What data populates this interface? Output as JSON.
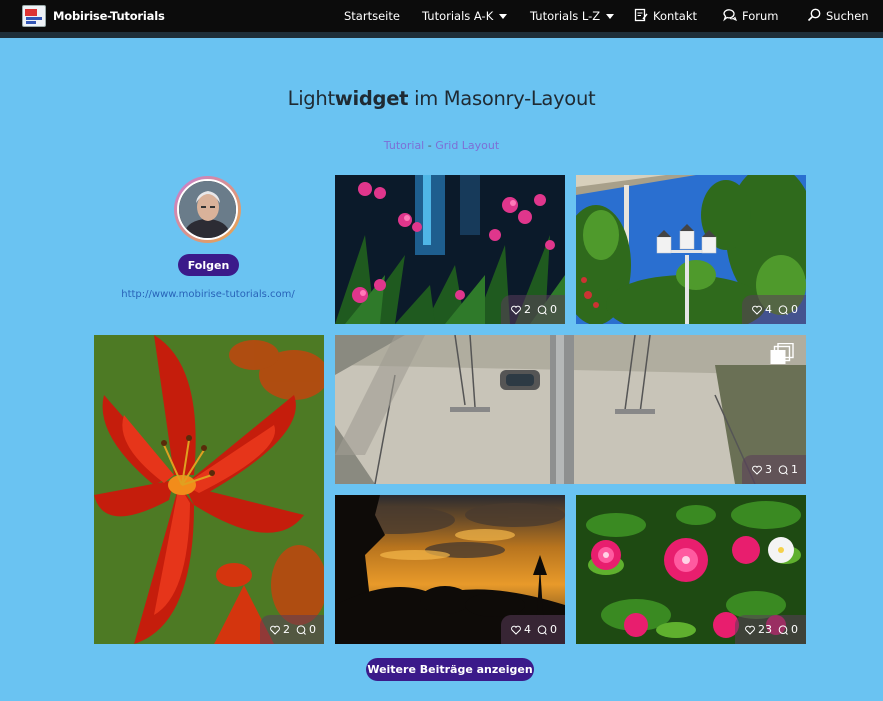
{
  "nav": {
    "brand": "Mobirise-Tutorials",
    "items": [
      {
        "label": "Startseite"
      },
      {
        "label": "Tutorials A-K"
      },
      {
        "label": "Tutorials L-Z"
      },
      {
        "label": "Kontakt",
        "icon": "form-icon"
      },
      {
        "label": "Forum",
        "icon": "chat-icon"
      },
      {
        "label": "Suchen",
        "icon": "search-icon"
      }
    ]
  },
  "header": {
    "title_pre": "Light",
    "title_bold": "widget",
    "title_post": " im Masonry-Layout",
    "crumb_1": "Tutorial",
    "crumb_sep": " - ",
    "crumb_2": "Grid Layout"
  },
  "profile": {
    "follow_label": "Folgen",
    "site_url": "http://www.mobirise-tutorials.com/"
  },
  "posts": [
    {
      "likes": "2",
      "comments": "0"
    },
    {
      "likes": "4",
      "comments": "0"
    },
    {
      "likes": "3",
      "comments": "1"
    },
    {
      "likes": "2",
      "comments": "0"
    },
    {
      "likes": "4",
      "comments": "0"
    },
    {
      "likes": "23",
      "comments": "0"
    }
  ],
  "load_more": "Weitere Beiträge anzeigen",
  "colors": {
    "background": "#6ac3f2",
    "navbar": "#0c0c0c",
    "button": "#3b1a8a",
    "link": "#7d6fd6"
  }
}
